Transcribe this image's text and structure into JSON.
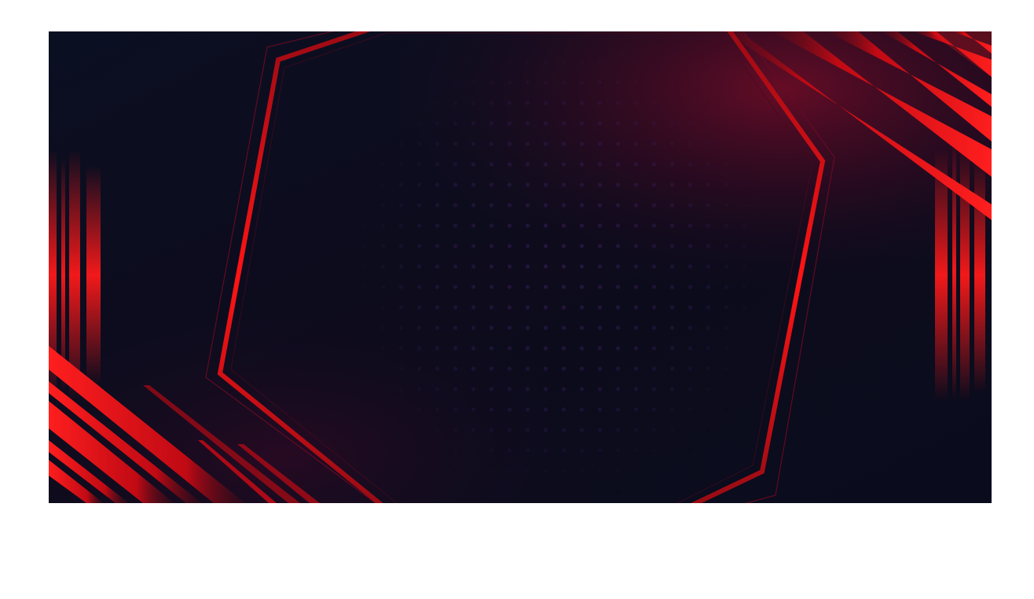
{
  "image": {
    "subject": "abstract-hexagon-background",
    "colors": {
      "background_dark": "#0a0d1e",
      "background_mid": "#120c22",
      "glow_maroon": "#5a0b22",
      "accent_red": "#ff1a1a",
      "accent_red_dark": "#7a0a14",
      "dot_color": "#2a1a4a",
      "page_bg": "#ffffff"
    }
  }
}
